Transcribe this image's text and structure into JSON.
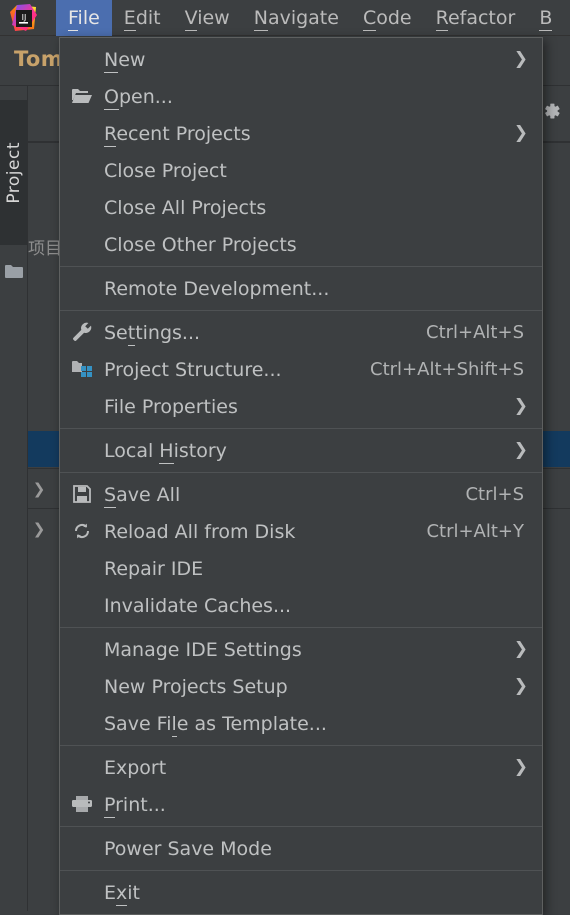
{
  "window": {
    "app": "IntelliJ IDEA",
    "logo_icon": "intellij-idea-logo"
  },
  "menubar": {
    "items": [
      {
        "label": "File",
        "mnemonic": "F",
        "active": true
      },
      {
        "label": "Edit",
        "mnemonic": "E",
        "active": false
      },
      {
        "label": "View",
        "mnemonic": "V",
        "active": false
      },
      {
        "label": "Navigate",
        "mnemonic": "N",
        "active": false
      },
      {
        "label": "Code",
        "mnemonic": "C",
        "active": false
      },
      {
        "label": "Refactor",
        "mnemonic": "R",
        "active": false
      },
      {
        "label": "B",
        "mnemonic": "B",
        "active": false
      }
    ]
  },
  "project": {
    "name": "Tom",
    "tool_window_label": "Project",
    "folder_icon": "folder-icon",
    "gear_icon": "gear-icon",
    "partial_text": "项目"
  },
  "file_menu": {
    "groups": [
      {
        "items": [
          {
            "label": "New",
            "mnemonic": "N",
            "icon": null,
            "shortcut": null,
            "submenu": true
          },
          {
            "label": "Open...",
            "mnemonic": "O",
            "icon": "open-folder-icon",
            "shortcut": null,
            "submenu": false
          },
          {
            "label": "Recent Projects",
            "mnemonic": "R",
            "icon": null,
            "shortcut": null,
            "submenu": true
          },
          {
            "label": "Close Project",
            "mnemonic": null,
            "icon": null,
            "shortcut": null,
            "submenu": false
          },
          {
            "label": "Close All Projects",
            "mnemonic": null,
            "icon": null,
            "shortcut": null,
            "submenu": false
          },
          {
            "label": "Close Other Projects",
            "mnemonic": null,
            "icon": null,
            "shortcut": null,
            "submenu": false
          }
        ]
      },
      {
        "items": [
          {
            "label": "Remote Development...",
            "mnemonic": null,
            "icon": null,
            "shortcut": null,
            "submenu": false
          }
        ]
      },
      {
        "items": [
          {
            "label": "Settings...",
            "mnemonic": "t",
            "icon": "wrench-icon",
            "shortcut": "Ctrl+Alt+S",
            "submenu": false
          },
          {
            "label": "Project Structure...",
            "mnemonic": null,
            "icon": "project-structure-icon",
            "shortcut": "Ctrl+Alt+Shift+S",
            "submenu": false
          },
          {
            "label": "File Properties",
            "mnemonic": null,
            "icon": null,
            "shortcut": null,
            "submenu": true
          }
        ]
      },
      {
        "items": [
          {
            "label": "Local History",
            "mnemonic": "H",
            "icon": null,
            "shortcut": null,
            "submenu": true
          }
        ]
      },
      {
        "items": [
          {
            "label": "Save All",
            "mnemonic": "S",
            "icon": "save-icon",
            "shortcut": "Ctrl+S",
            "submenu": false
          },
          {
            "label": "Reload All from Disk",
            "mnemonic": null,
            "icon": "reload-icon",
            "shortcut": "Ctrl+Alt+Y",
            "submenu": false
          },
          {
            "label": "Repair IDE",
            "mnemonic": null,
            "icon": null,
            "shortcut": null,
            "submenu": false
          },
          {
            "label": "Invalidate Caches...",
            "mnemonic": null,
            "icon": null,
            "shortcut": null,
            "submenu": false
          }
        ]
      },
      {
        "items": [
          {
            "label": "Manage IDE Settings",
            "mnemonic": null,
            "icon": null,
            "shortcut": null,
            "submenu": true
          },
          {
            "label": "New Projects Setup",
            "mnemonic": null,
            "icon": null,
            "shortcut": null,
            "submenu": true
          },
          {
            "label": "Save File as Template...",
            "mnemonic": "l",
            "icon": null,
            "shortcut": null,
            "submenu": false
          }
        ]
      },
      {
        "items": [
          {
            "label": "Export",
            "mnemonic": null,
            "icon": null,
            "shortcut": null,
            "submenu": true
          },
          {
            "label": "Print...",
            "mnemonic": "P",
            "icon": "printer-icon",
            "shortcut": null,
            "submenu": false
          }
        ]
      },
      {
        "items": [
          {
            "label": "Power Save Mode",
            "mnemonic": null,
            "icon": null,
            "shortcut": null,
            "submenu": false
          }
        ]
      },
      {
        "items": [
          {
            "label": "Exit",
            "mnemonic": "x",
            "icon": null,
            "shortcut": null,
            "submenu": false
          }
        ]
      }
    ]
  },
  "colors": {
    "menu_bg": "#3c3f41",
    "menu_border": "#5e6060",
    "accent_blue": "#4b6eaf",
    "selection_blue": "#133a5e",
    "text": "#bfc1c2",
    "project_name": "#c8a26a"
  }
}
